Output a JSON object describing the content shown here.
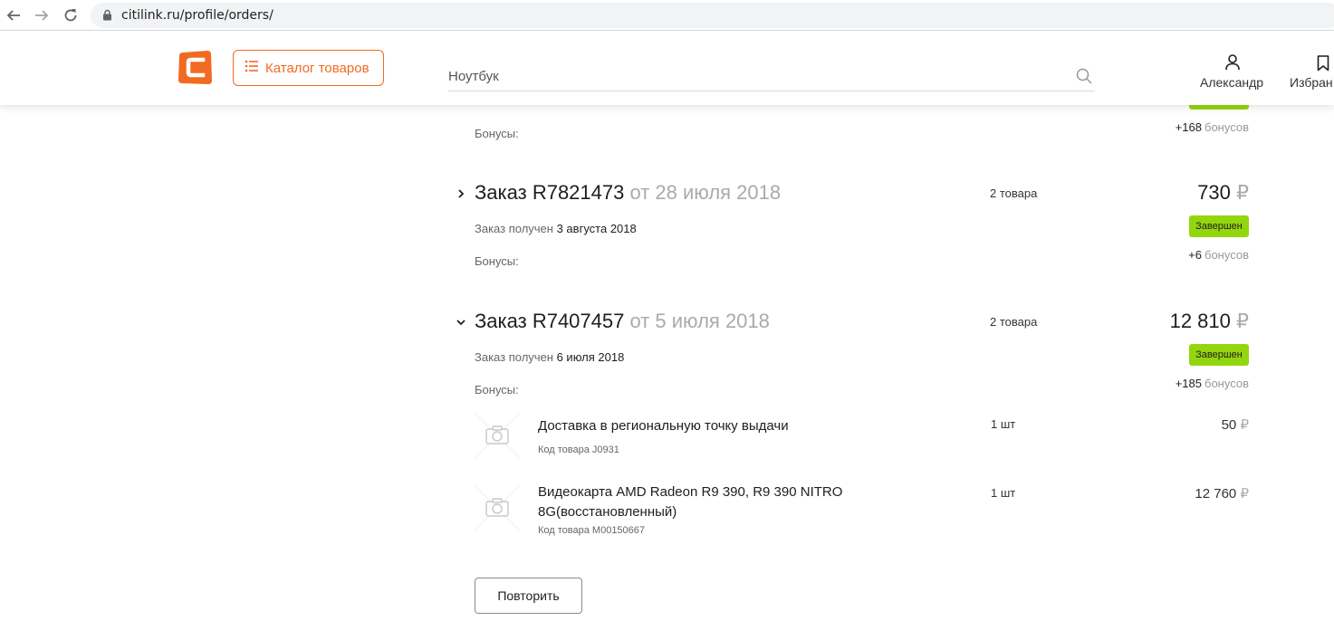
{
  "browser": {
    "url": "citilink.ru/profile/orders/"
  },
  "header": {
    "catalog_label": "Каталог товаров",
    "search_placeholder": "Ноутбук",
    "user_label": "Александр",
    "favorites_label": "Избран",
    "brand_color": "#f26a22"
  },
  "previous_order": {
    "bonuses_label": "Бонусы:",
    "bonus_amount": "+168",
    "bonus_unit": "бонусов"
  },
  "orders": [
    {
      "title": "Заказ R7821473",
      "date": "от 28 июля 2018",
      "items_count": "2 товара",
      "sum": "730",
      "currency": "₽",
      "received_label": "Заказ получен",
      "received_date": "3 августа 2018",
      "status": "Завершен",
      "bonuses_label": "Бонусы:",
      "bonus_amount": "+6",
      "bonus_unit": "бонусов",
      "expanded": false
    },
    {
      "title": "Заказ R7407457",
      "date": "от 5 июля 2018",
      "items_count": "2 товара",
      "sum": "12 810",
      "currency": "₽",
      "received_label": "Заказ получен",
      "received_date": "6 июля 2018",
      "status": "Завершен",
      "bonuses_label": "Бонусы:",
      "bonus_amount": "+185",
      "bonus_unit": "бонусов",
      "expanded": true,
      "items": [
        {
          "name": "Доставка в региональную точку выдачи",
          "code": "Код товара J0931",
          "qty": "1 шт",
          "price": "50",
          "currency": "₽"
        },
        {
          "name_line1": "Видеокарта AMD Radeon R9 390, R9 390 NITRO",
          "name_line2": "8G(восстановленный)",
          "code": "Код товара M00150667",
          "qty": "1 шт",
          "price": "12 760",
          "currency": "₽"
        }
      ],
      "repeat_label": "Повторить"
    }
  ],
  "status_color": "#94d60e"
}
